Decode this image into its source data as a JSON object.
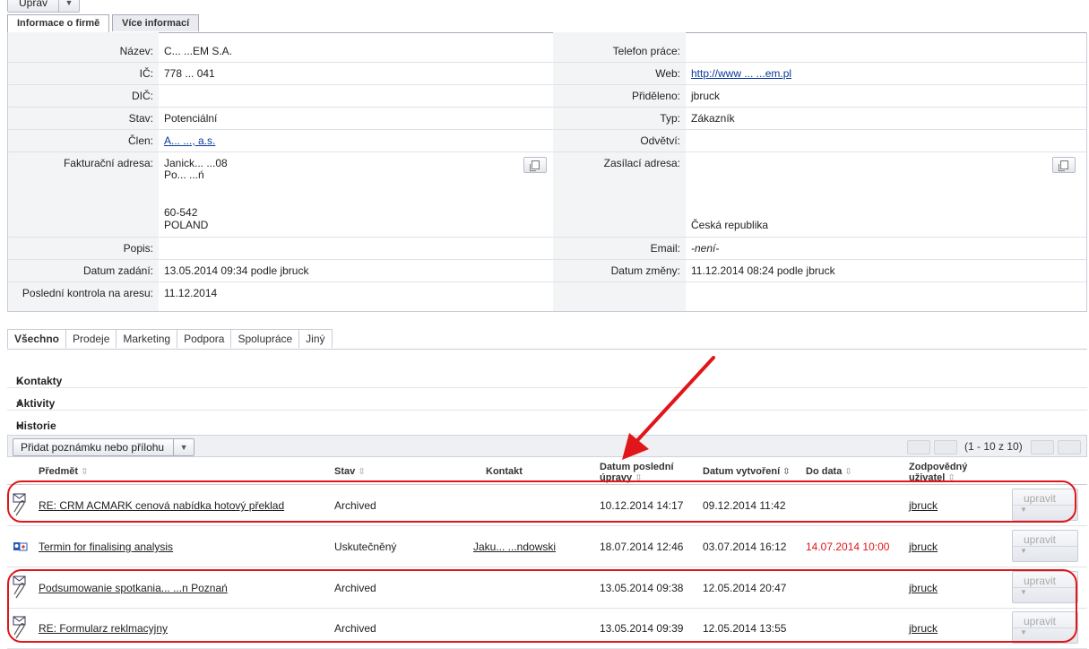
{
  "toolbar_top": {
    "edit_label": "Uprav"
  },
  "detail_tabs": [
    {
      "label": "Informace o firmě"
    },
    {
      "label": "Více informací"
    }
  ],
  "fields": {
    "nazev": {
      "label": "Název:",
      "value": "C...  ...EM S.A."
    },
    "ic": {
      "label": "IČ:",
      "value": "778  ...  041"
    },
    "dic": {
      "label": "DIČ:",
      "value": ""
    },
    "stav": {
      "label": "Stav:",
      "value": "Potenciální"
    },
    "clen": {
      "label": "Člen:",
      "value": "A...  ..., a.s."
    },
    "fakt": {
      "label": "Fakturační adresa:",
      "line1": "Janick...  ...08",
      "line2": "Po...  ...ń",
      "line3": "60-542",
      "line4": "POLAND"
    },
    "popis": {
      "label": "Popis:",
      "value": ""
    },
    "datum_zadani": {
      "label": "Datum zadání:",
      "value": "13.05.2014 09:34 podle jbruck"
    },
    "posledni_kontrola": {
      "label": "Poslední kontrola na aresu:",
      "value": "11.12.2014"
    },
    "telefon": {
      "label": "Telefon práce:",
      "value": ""
    },
    "web": {
      "label": "Web:",
      "value": "http://www  ...  ...em.pl"
    },
    "prideleno": {
      "label": "Přiděleno:",
      "value": "jbruck"
    },
    "typ": {
      "label": "Typ:",
      "value": "Zákazník"
    },
    "odvetvi": {
      "label": "Odvětví:",
      "value": ""
    },
    "zasilaci": {
      "label": "Zasílací adresa:",
      "country": "Česká republika"
    },
    "email": {
      "label": "Email:",
      "value": "-není-"
    },
    "datum_zmeny": {
      "label": "Datum změny:",
      "value": "11.12.2014 08:24 podle jbruck"
    }
  },
  "filter_tabs": [
    {
      "label": "Všechno"
    },
    {
      "label": "Prodeje"
    },
    {
      "label": "Marketing"
    },
    {
      "label": "Podpora"
    },
    {
      "label": "Spolupráce"
    },
    {
      "label": "Jiný"
    }
  ],
  "sections": {
    "kontakty": "Kontakty",
    "aktivity": "Aktivity",
    "historie": "Historie"
  },
  "history_toolbar": {
    "add_label": "Přidat poznámku nebo přílohu",
    "paging": "(1 - 10 z 10)"
  },
  "columns": {
    "predmet": "Předmět",
    "stav": "Stav",
    "kontakt": "Kontakt",
    "datum_posledni_1": "Datum poslední",
    "datum_posledni_2": "úpravy",
    "datum_vytvoreni": "Datum vytvoření",
    "do_data": "Do data",
    "zodpovedny_1": "Zodpovědný",
    "zodpovedny_2": "uživatel"
  },
  "rows": [
    {
      "subject": "RE: CRM ACMARK  cenová nabídka  hotový překlad",
      "status": "Archived",
      "contact": "",
      "modified": "10.12.2014 14:17",
      "created": "09.12.2014 11:42",
      "due": "",
      "user": "jbruck",
      "edit": "upravit",
      "icon": "email-attachment-icon"
    },
    {
      "subject": "Termin for finalising analysis",
      "status": "Uskutečněný",
      "contact": "Jaku...  ...ndowski",
      "modified": "18.07.2014 12:46",
      "created": "03.07.2014 16:12",
      "due": "14.07.2014 10:00",
      "user": "jbruck",
      "edit": "upravit",
      "icon": "meeting-icon"
    },
    {
      "subject": "Podsumowanie spotkania...  ...n Poznań",
      "status": "Archived",
      "contact": "",
      "modified": "13.05.2014 09:38",
      "created": "12.05.2014 20:47",
      "due": "",
      "user": "jbruck",
      "edit": "upravit",
      "icon": "email-attachment-icon"
    },
    {
      "subject": "RE: Formularz reklmacyjny",
      "status": "Archived",
      "contact": "",
      "modified": "13.05.2014 09:39",
      "created": "12.05.2014 13:55",
      "due": "",
      "user": "jbruck",
      "edit": "upravit",
      "icon": "email-attachment-icon"
    }
  ],
  "colors": {
    "due_overdue": "#e0161a",
    "annotation": "#e0161a",
    "link": "#0a3a9a"
  }
}
